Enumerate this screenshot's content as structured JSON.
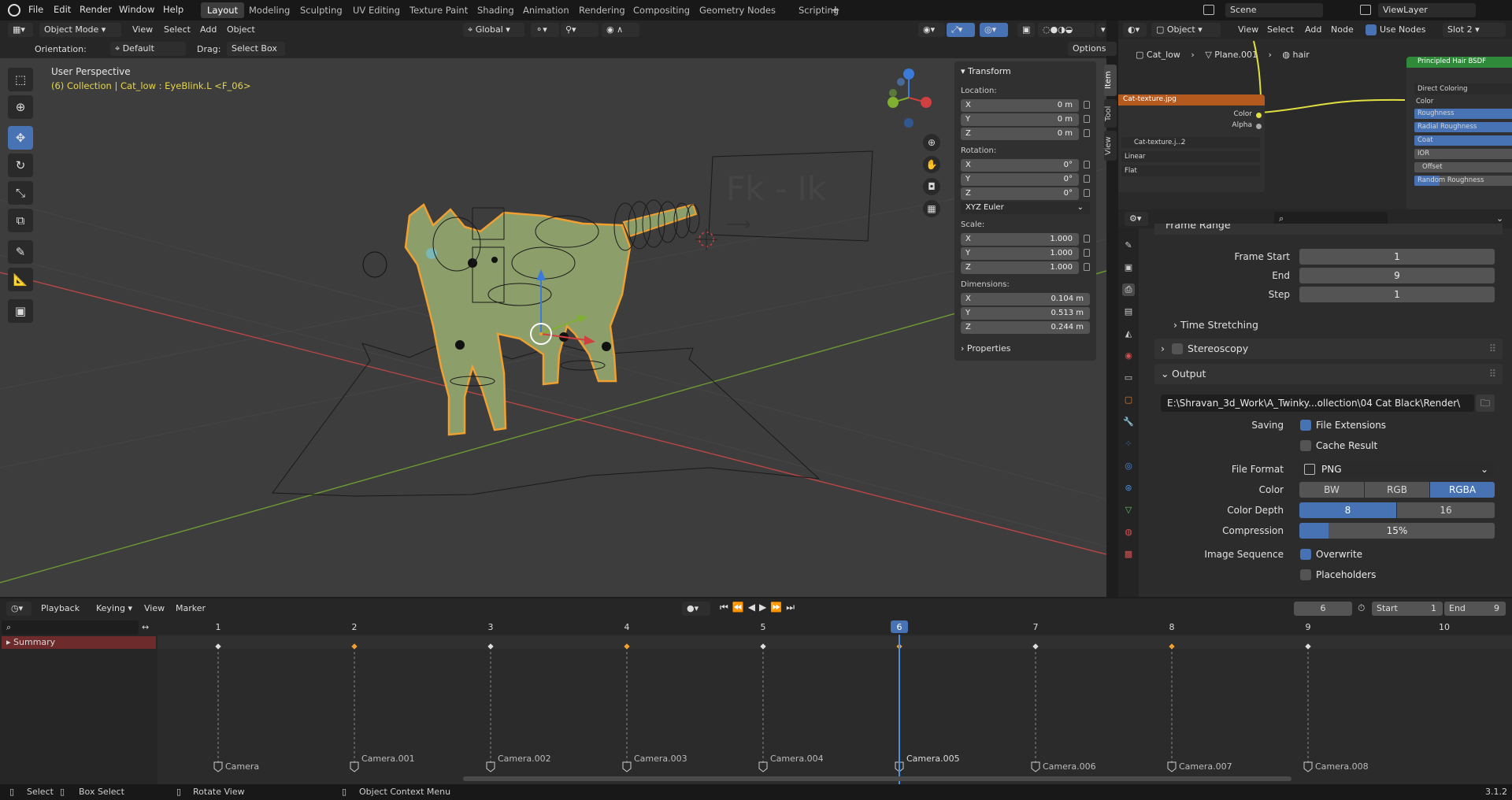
{
  "topbar": {
    "menus": [
      "File",
      "Edit",
      "Render",
      "Window",
      "Help"
    ],
    "workspaces": [
      "Layout",
      "Modeling",
      "Sculpting",
      "UV Editing",
      "Texture Paint",
      "Shading",
      "Animation",
      "Rendering",
      "Compositing",
      "Geometry Nodes",
      "Scripting"
    ],
    "active_workspace": "Layout",
    "add_tab": "+",
    "scene": "Scene",
    "view_layer": "ViewLayer"
  },
  "viewport_header": {
    "mode": "Object Mode",
    "menus": [
      "View",
      "Select",
      "Add",
      "Object"
    ],
    "transform_orientation": "Global",
    "orientation_label": "Orientation:",
    "orientation_value": "Default",
    "drag_label": "Drag:",
    "drag_value": "Select Box",
    "options": "Options"
  },
  "viewport": {
    "title": "User Perspective",
    "subtitle": "(6) Collection | Cat_low : EyeBlink.L <F_06>",
    "board_text": "Fk  -  Ik",
    "board_arrow": "⟶"
  },
  "npanel": {
    "tabs": [
      "Item",
      "Tool",
      "View"
    ],
    "active_tab": "Item",
    "section": "Transform",
    "location_label": "Location:",
    "location": [
      {
        "axis": "X",
        "value": "0 m"
      },
      {
        "axis": "Y",
        "value": "0 m"
      },
      {
        "axis": "Z",
        "value": "0 m"
      }
    ],
    "rotation_label": "Rotation:",
    "rotation": [
      {
        "axis": "X",
        "value": "0°"
      },
      {
        "axis": "Y",
        "value": "0°"
      },
      {
        "axis": "Z",
        "value": "0°"
      }
    ],
    "rotation_mode": "XYZ Euler",
    "scale_label": "Scale:",
    "scale": [
      {
        "axis": "X",
        "value": "1.000"
      },
      {
        "axis": "Y",
        "value": "1.000"
      },
      {
        "axis": "Z",
        "value": "1.000"
      }
    ],
    "dimensions_label": "Dimensions:",
    "dimensions": [
      {
        "axis": "X",
        "value": "0.104 m"
      },
      {
        "axis": "Y",
        "value": "0.513 m"
      },
      {
        "axis": "Z",
        "value": "0.244 m"
      }
    ],
    "properties": "Properties"
  },
  "shader": {
    "object_mode": "Object",
    "menus": [
      "View",
      "Select",
      "Add",
      "Node"
    ],
    "use_nodes": "Use Nodes",
    "slot": "Slot 2",
    "breadcrumb": [
      "Cat_low",
      "Plane.001",
      "hair"
    ],
    "texture_node": "Cat-texture.jpg",
    "texture_outputs": [
      "Color",
      "Alpha"
    ],
    "texture_image": "Cat-texture.j...",
    "texture_users": "2",
    "interpolation": "Linear",
    "projection": "Flat",
    "bsdf_title": "Principled Hair BSDF",
    "bsdf_mode": "Direct Coloring",
    "bsdf_inputs": [
      "Color",
      "Roughness",
      "Radial Roughness",
      "Coat",
      "IOR",
      "Offset",
      "Random Roughness"
    ]
  },
  "properties": {
    "frame_range": "Frame Range",
    "frame_start_label": "Frame Start",
    "frame_start": "1",
    "end_label": "End",
    "end": "9",
    "step_label": "Step",
    "step": "1",
    "time_stretching": "Time Stretching",
    "stereoscopy": "Stereoscopy",
    "output": "Output",
    "output_path": "E:\\Shravan_3d_Work\\A_Twinky...ollection\\04 Cat Black\\Render\\",
    "saving_label": "Saving",
    "file_extensions": "File Extensions",
    "cache_result": "Cache Result",
    "file_format_label": "File Format",
    "file_format": "PNG",
    "color_label": "Color",
    "color_options": [
      "BW",
      "RGB",
      "RGBA"
    ],
    "color_selected": "RGBA",
    "color_depth_label": "Color Depth",
    "color_depth_options": [
      "8",
      "16"
    ],
    "color_depth_selected": "8",
    "compression_label": "Compression",
    "compression": "15%",
    "compression_fraction": 0.15,
    "image_sequence_label": "Image Sequence",
    "overwrite": "Overwrite",
    "placeholders": "Placeholders"
  },
  "timeline": {
    "menus": [
      "Playback",
      "Keying",
      "View",
      "Marker"
    ],
    "current_frame": "6",
    "start_label": "Start",
    "start": "1",
    "end_label": "End",
    "end": "9",
    "summary": "Summary",
    "frames": [
      "1",
      "2",
      "3",
      "4",
      "5",
      "6",
      "7",
      "8",
      "9",
      "10"
    ],
    "markers": [
      "Camera",
      "Camera.001",
      "Camera.002",
      "Camera.003",
      "Camera.004",
      "Camera.005",
      "Camera.006",
      "Camera.007",
      "Camera.008"
    ]
  },
  "statusbar": {
    "select": "Select",
    "box_select": "Box Select",
    "rotate_view": "Rotate View",
    "context_menu": "Object Context Menu",
    "version": "3.1.2"
  },
  "colors": {
    "accent": "#4772b3",
    "selection_orange": "#f0a030",
    "x_axis": "#d04040",
    "y_axis": "#80b030",
    "z_axis": "#3a7ad8"
  }
}
